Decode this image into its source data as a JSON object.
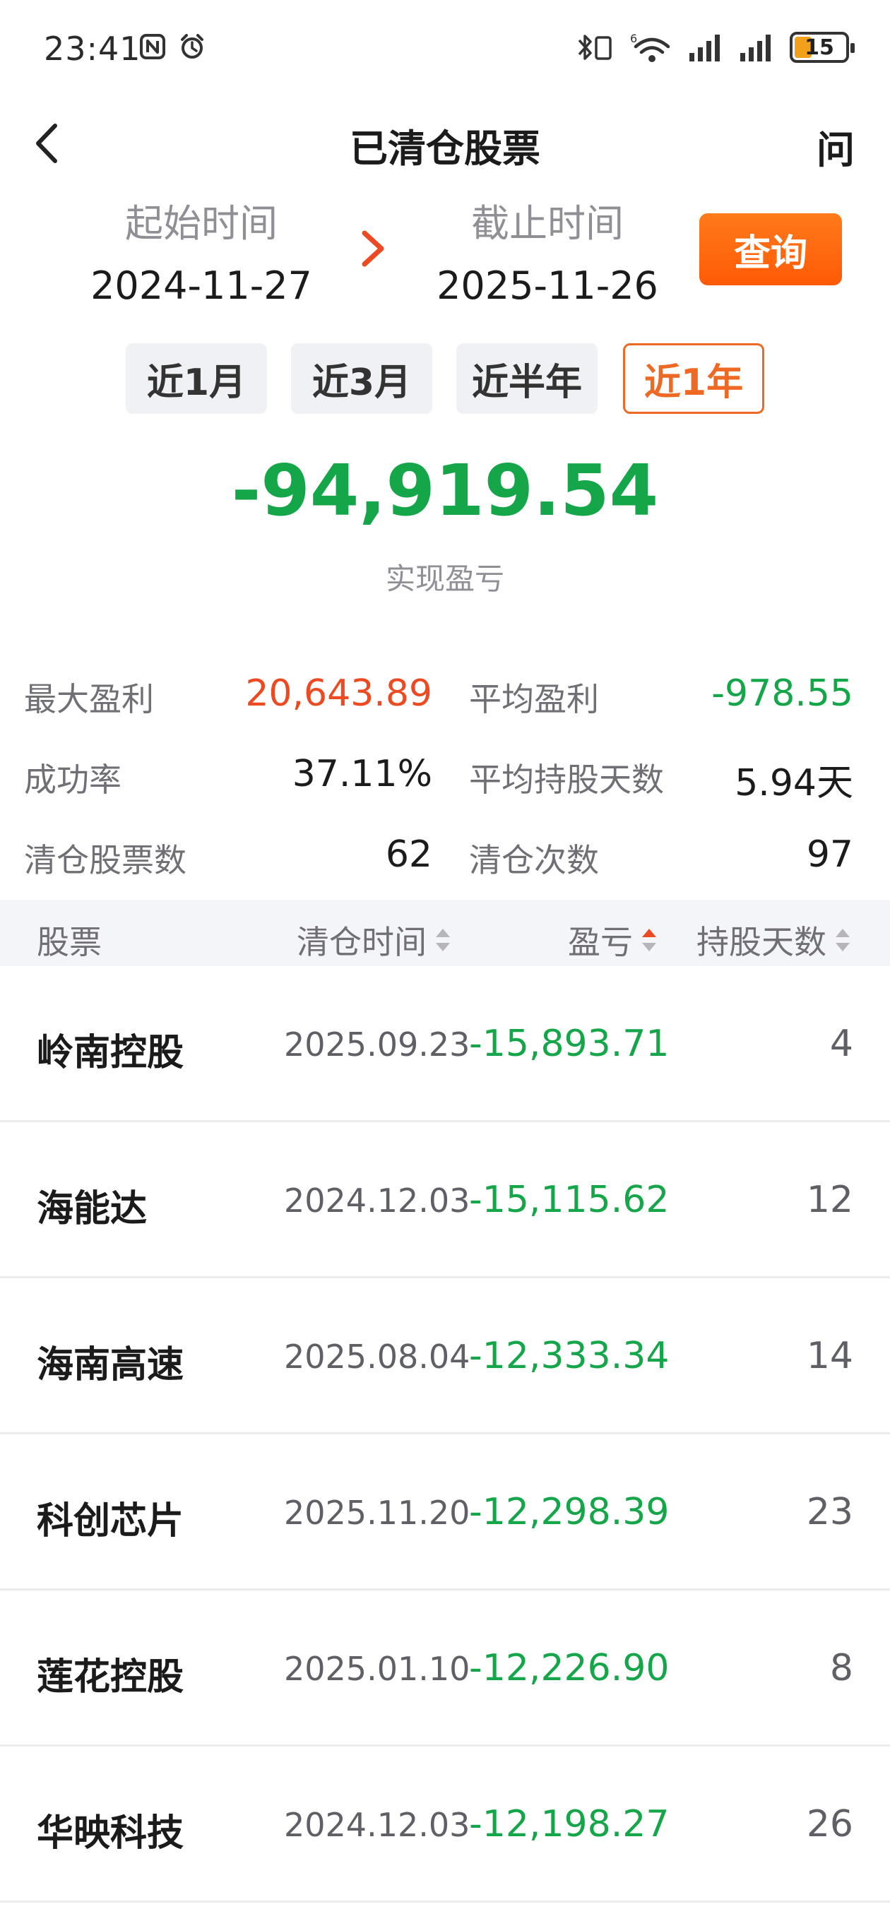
{
  "status_bar": {
    "time": "23:41",
    "battery": "15",
    "wifi_badge": "6"
  },
  "nav": {
    "title": "已清仓股票",
    "help": "问"
  },
  "date_range": {
    "start_label": "起始时间",
    "start_value": "2024-11-27",
    "end_label": "截止时间",
    "end_value": "2025-11-26",
    "query_label": "查询"
  },
  "periods": [
    {
      "label": "近1月",
      "active": false
    },
    {
      "label": "近3月",
      "active": false
    },
    {
      "label": "近半年",
      "active": false
    },
    {
      "label": "近1年",
      "active": true
    }
  ],
  "summary": {
    "realized_pnl": "-94,919.54",
    "realized_pnl_label": "实现盈亏"
  },
  "stats": [
    {
      "label": "最大盈利",
      "value": "20,643.89",
      "color": "#ee4a22"
    },
    {
      "label": "平均盈利",
      "value": "-978.55",
      "color": "#15a64a"
    },
    {
      "label": "成功率",
      "value": "37.11%",
      "color": "#1b1b1b"
    },
    {
      "label": "平均持股天数",
      "value": "5.94天",
      "color": "#1b1b1b"
    },
    {
      "label": "清仓股票数",
      "value": "62",
      "color": "#1b1b1b"
    },
    {
      "label": "清仓次数",
      "value": "97",
      "color": "#1b1b1b"
    }
  ],
  "table": {
    "headers": [
      "股票",
      "清仓时间",
      "盈亏",
      "持股天数"
    ],
    "rows": [
      {
        "name": "岭南控股",
        "date": "2025.09.23",
        "pnl": "-15,893.71",
        "days": "4"
      },
      {
        "name": "海能达",
        "date": "2024.12.03",
        "pnl": "-15,115.62",
        "days": "12"
      },
      {
        "name": "海南高速",
        "date": "2025.08.04",
        "pnl": "-12,333.34",
        "days": "14"
      },
      {
        "name": "科创芯片",
        "date": "2025.11.20",
        "pnl": "-12,298.39",
        "days": "23"
      },
      {
        "name": "莲花控股",
        "date": "2025.01.10",
        "pnl": "-12,226.90",
        "days": "8"
      },
      {
        "name": "华映科技",
        "date": "2024.12.03",
        "pnl": "-12,198.27",
        "days": "26"
      }
    ]
  },
  "colors": {
    "accent": "#ee6a24",
    "loss": "#15a64a",
    "gain": "#ee4a22"
  }
}
